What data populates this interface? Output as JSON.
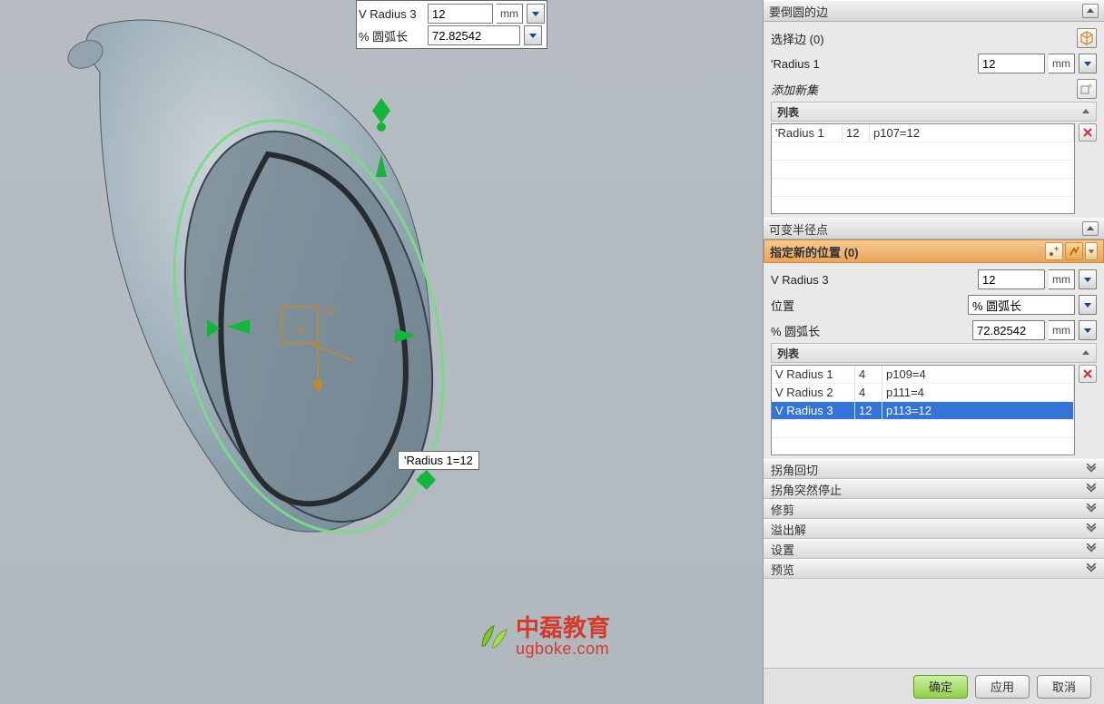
{
  "float": {
    "row1_label": "V Radius 3",
    "row1_value": "12",
    "row1_unit": "mm",
    "row2_label": "% 圆弧长",
    "row2_value": "72.82542"
  },
  "annotation": "'Radius 1=12",
  "panel": {
    "section_edges": {
      "title": "要倒圆的边",
      "select_label_prefix": "选择边 (",
      "select_count": "0",
      "select_label_suffix": ")",
      "radius_label": "'Radius 1",
      "radius_value": "12",
      "radius_unit": "mm",
      "add_set": "添加新集",
      "list_title": "列表",
      "list_row": {
        "c1": "'Radius 1",
        "c2": "12",
        "c3": "p107=12"
      }
    },
    "section_varpts": {
      "title": "可变半径点",
      "specify_label_prefix": "指定新的位置 (",
      "specify_count": "0",
      "specify_label_suffix": ")",
      "vr_label": "V Radius 3",
      "vr_value": "12",
      "vr_unit": "mm",
      "pos_label": "位置",
      "pos_value": "% 圆弧长",
      "arc_label": "% 圆弧长",
      "arc_value": "72.82542",
      "arc_unit": "mm",
      "list_title": "列表",
      "rows": [
        {
          "c1": "V Radius 1",
          "c2": "4",
          "c3": "p109=4",
          "selected": false
        },
        {
          "c1": "V Radius 2",
          "c2": "4",
          "c3": "p111=4",
          "selected": false
        },
        {
          "c1": "V Radius 3",
          "c2": "12",
          "c3": "p113=12",
          "selected": true
        }
      ]
    },
    "collapsed": [
      "拐角回切",
      "拐角突然停止",
      "修剪",
      "溢出解",
      "设置",
      "预览"
    ],
    "buttons": {
      "ok": "确定",
      "apply": "应用",
      "cancel": "取消"
    }
  },
  "logo": {
    "line1": "中磊教育",
    "line2": "ugboke.com"
  }
}
